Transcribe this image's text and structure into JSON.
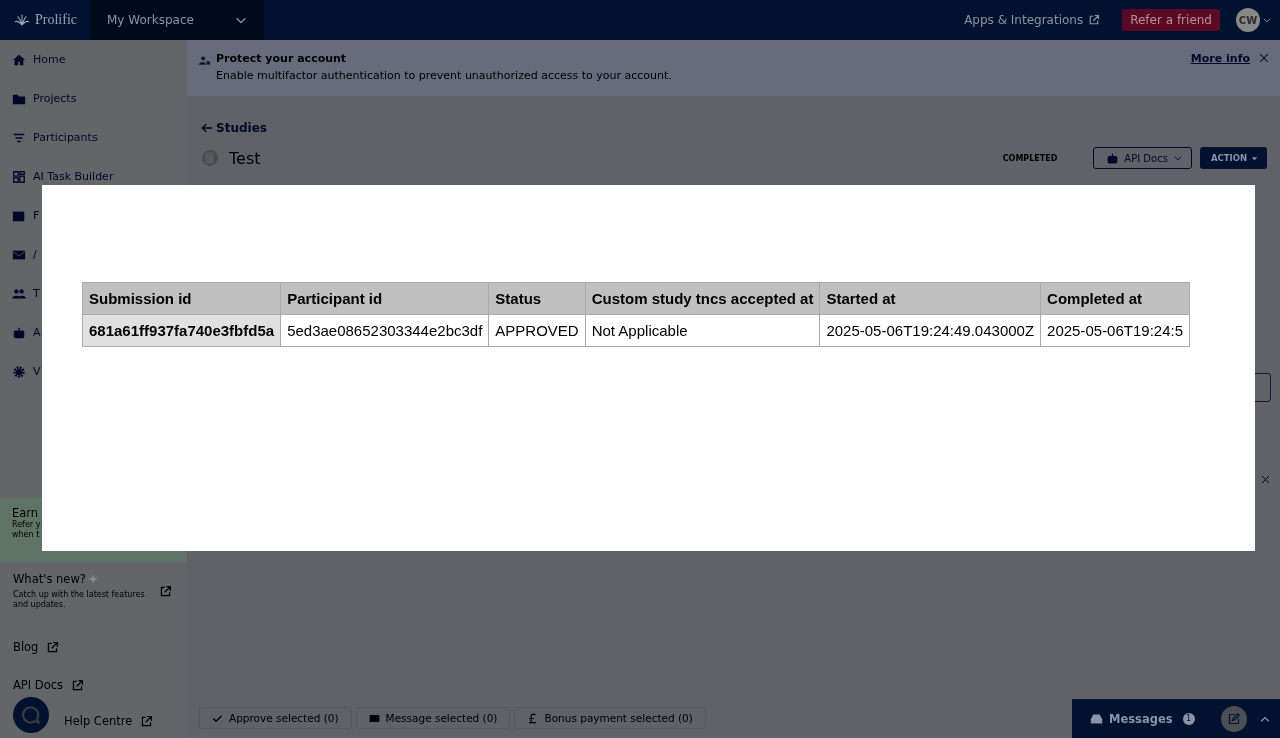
{
  "header": {
    "logo": "Prolific",
    "workspace": "My Workspace",
    "apps_link": "Apps & Integrations",
    "refer_button": "Refer a friend",
    "avatar": "CW"
  },
  "sidebar": {
    "items": [
      {
        "label": "Home"
      },
      {
        "label": "Projects"
      },
      {
        "label": "Participants"
      },
      {
        "label": "AI Task Builder"
      },
      {
        "label": "F"
      },
      {
        "label": "/"
      },
      {
        "label": "T"
      },
      {
        "label": "A"
      },
      {
        "label": "V"
      }
    ],
    "promo": {
      "title": "Earn",
      "lines": [
        "Refer y",
        "when t"
      ]
    },
    "whats_new": {
      "title": "What's new?",
      "text": "Catch up with the latest features and updates."
    },
    "links": [
      "Blog",
      "API Docs",
      "Help Centre"
    ]
  },
  "banner": {
    "title": "Protect your account",
    "text": "Enable multifactor authentication to prevent unauthorized access to your account.",
    "link": "More info"
  },
  "study": {
    "back_link": "Studies",
    "title": "Test",
    "status": "COMPLETED",
    "api_button": "API Docs",
    "action_button": "ACTION"
  },
  "bottom_bar": {
    "buttons": [
      "Approve selected (0)",
      "Message selected (0)",
      "Bonus payment selected (0)"
    ]
  },
  "messages": {
    "label": "Messages",
    "count": "1"
  },
  "modal": {
    "table": {
      "columns": [
        "Submission id",
        "Participant id",
        "Status",
        "Custom study tncs accepted at",
        "Started at",
        "Completed at"
      ],
      "rows": [
        [
          "681a61ff937fa740e3fbfd5a",
          "5ed3ae08652303344e2bc3df",
          "APPROVED",
          "Not Applicable",
          "2025-05-06T19:24:49.043000Z",
          "2025-05-06T19:24:5"
        ]
      ]
    }
  }
}
